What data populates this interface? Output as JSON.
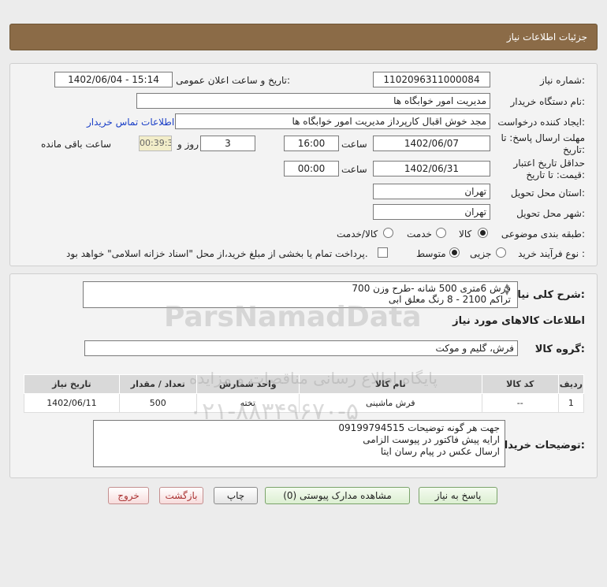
{
  "header": {
    "title": "جزئیات اطلاعات نیاز"
  },
  "form": {
    "need_number_label": "شماره نیاز:",
    "need_number": "1102096311000084",
    "announce_label": "تاریخ و ساعت اعلان عمومی:",
    "announce_value": "1402/06/04 - 15:14",
    "buyer_org_label": "نام دستگاه خریدار:",
    "buyer_org": "مدیریت امور خوابگاه ها",
    "creator_label": "ایجاد کننده درخواست:",
    "creator": "مجد خوش اقبال کارپرداز مدیریت امور خوابگاه ها",
    "contact_link": "اطلاعات تماس خریدار",
    "deadline_label_1": "مهلت ارسال پاسخ: تا",
    "deadline_label_2": "تاریخ:",
    "deadline_date": "1402/06/07",
    "time_label": "ساعت",
    "deadline_time": "16:00",
    "days_value": "3",
    "days_label": "روز و",
    "remaining_time": "00:39:31",
    "remaining_label": "ساعت باقی مانده",
    "validity_label_1": "حداقل تاریخ اعتبار",
    "validity_label_2": "قیمت: تا تاریخ:",
    "validity_date": "1402/06/31",
    "validity_time": "00:00",
    "province_label": "استان محل تحویل:",
    "province": "تهران",
    "city_label": "شهر محل تحویل:",
    "city": "تهران",
    "category_label": "طبقه بندی موضوعی:",
    "category_options": [
      "کالا",
      "خدمت",
      "کالا/خدمت"
    ],
    "process_label": "نوع فرآیند خرید :",
    "process_options": [
      "جزیی",
      "متوسط"
    ],
    "payment_note": "پرداخت تمام یا بخشی از مبلغ خرید،از محل \"اسناد خزانه اسلامی\" خواهد بود."
  },
  "summary": {
    "label": "شرح کلی نیاز:",
    "line1": "فرش 6متری 500 شانه -طرح وزن 700",
    "line2": "تراکم 2100  -  8 رنگ معلق ابی"
  },
  "goods": {
    "section_title": "اطلاعات کالاهای مورد نیاز",
    "group_label": "گروه کالا:",
    "group_value": "فرش، گلیم و موکت",
    "columns": [
      "ردیف",
      "کد کالا",
      "نام کالا",
      "واحد شمارش",
      "تعداد / مقدار",
      "تاریخ نیاز"
    ],
    "rows": [
      [
        "1",
        "--",
        "فرش ماشینی",
        "تخته",
        "500",
        "1402/06/11"
      ]
    ]
  },
  "notes": {
    "label": "توضیحات خریدار:",
    "line1": "جهت هر گونه توضیحات 09199794515",
    "line2": "ارایه پیش فاکتور در پیوست الزامی",
    "line3": "ارسال عکس در پیام رسان ایتا"
  },
  "buttons": {
    "reply": "پاسخ به نیاز",
    "attachments": "مشاهده مدارک پیوستی (0)",
    "print": "چاپ",
    "back": "بازگشت",
    "exit": "خروج"
  },
  "watermark": {
    "brand": "ParsNamadData",
    "tagline": "پایگاه اطلاع رسانی مناقصات و مزایده",
    "phone": "۰۲۱-۸۸۳۴۹۶۷۰-۵"
  }
}
